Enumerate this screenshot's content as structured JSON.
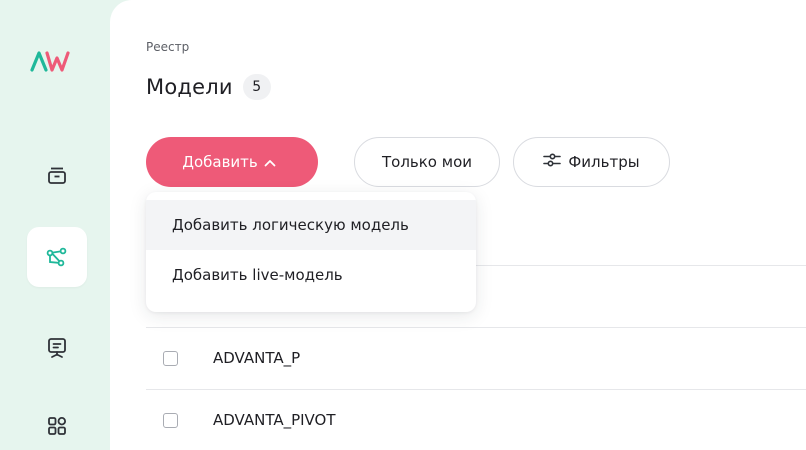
{
  "colors": {
    "accent": "#ee5a78",
    "sidebar_bg": "#e6f5ee",
    "logo_primary": "#1fb89a",
    "logo_secondary": "#ee5a78"
  },
  "sidebar": {
    "logo": "AW",
    "items": [
      {
        "icon": "archive-icon",
        "active": false
      },
      {
        "icon": "models-graph-icon",
        "active": true
      },
      {
        "icon": "presentation-icon",
        "active": false
      },
      {
        "icon": "apps-grid-icon",
        "active": false
      }
    ]
  },
  "header": {
    "breadcrumb": "Реестр",
    "title": "Модели",
    "count": "5"
  },
  "toolbar": {
    "add_label": "Добавить",
    "add_icon": "chevron-up-icon",
    "mine_label": "Только мои",
    "filters_label": "Фильтры",
    "filters_icon": "sliders-icon"
  },
  "add_menu": {
    "items": [
      {
        "label": "Добавить логическую модель"
      },
      {
        "label": "Добавить live-модель"
      }
    ]
  },
  "table": {
    "rows": [
      {
        "name": "ADVANTA_P",
        "checked": false
      },
      {
        "name": "ADVANTA_PIVOT",
        "checked": false
      }
    ]
  }
}
